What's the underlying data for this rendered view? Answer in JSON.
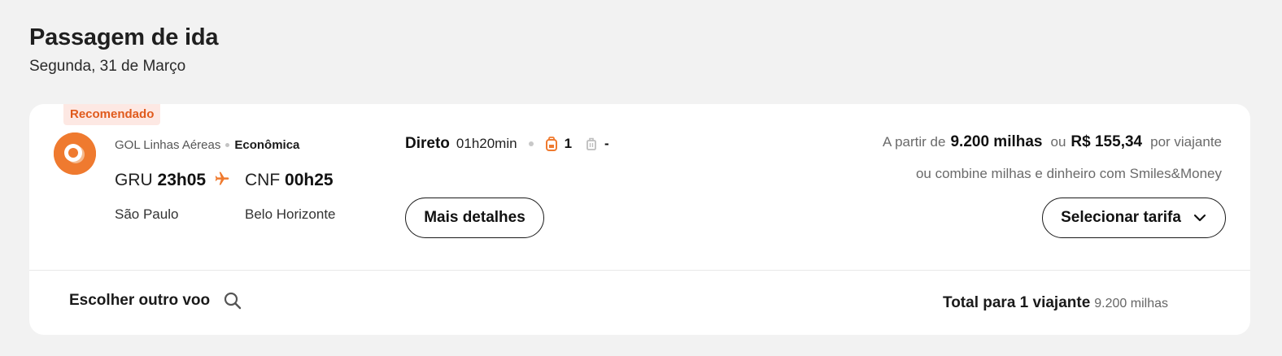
{
  "header": {
    "title": "Passagem de ida",
    "date": "Segunda, 31 de Março"
  },
  "flight": {
    "badge": "Recomendado",
    "airline": "GOL Linhas Aéreas",
    "cabin": "Econômica",
    "origin_code": "GRU",
    "origin_time": "23h05",
    "dest_code": "CNF",
    "dest_time": "00h25",
    "origin_city": "São Paulo",
    "dest_city": "Belo Horizonte",
    "stops": "Direto",
    "duration": "01h20min",
    "carry_on_count": "1",
    "checked_bag": "-",
    "details_label": "Mais detalhes",
    "price_prefix": "A partir de",
    "price_miles": "9.200 milhas",
    "price_or": "ou",
    "price_money": "R$ 155,34",
    "price_suffix": "por viajante",
    "combine_text": "ou combine milhas e dinheiro com Smiles&Money",
    "select_label": "Selecionar tarifa"
  },
  "footer": {
    "other_flight_label": "Escolher outro voo",
    "total_label": "Total para 1 viajante",
    "total_value": "9.200 milhas"
  },
  "colors": {
    "accent": "#ef7a2f",
    "badge_bg": "#fde8e3",
    "badge_text": "#e05a1c",
    "background": "#f2f2f2",
    "card": "#ffffff"
  },
  "icons": {
    "airline_logo": "gol-logo",
    "plane": "plane-icon",
    "carry_on": "backpack-icon",
    "checked": "suitcase-icon",
    "dropdown": "chevron-down-icon",
    "search": "search-icon"
  }
}
